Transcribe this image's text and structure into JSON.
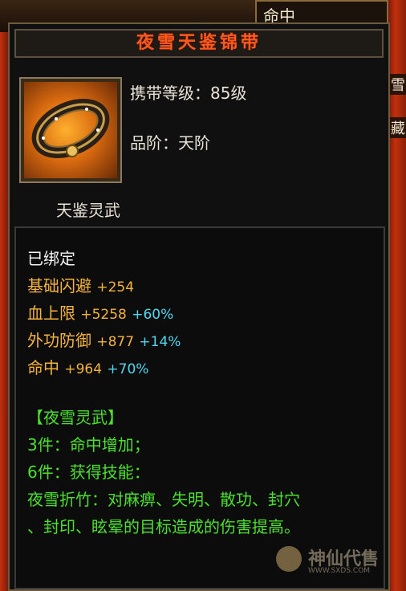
{
  "background": {
    "top_tab_label": "命中",
    "side_chars": [
      "雪",
      "藏"
    ]
  },
  "tooltip": {
    "title": "夜雪天鉴锦带",
    "icon": "belt-icon",
    "level_line": "携带等级：85级",
    "grade_line": "品阶：天阶",
    "subtitle": "天鉴灵武",
    "bound": "已绑定",
    "stats": [
      {
        "name": "基础闪避",
        "value": "+254",
        "percent": ""
      },
      {
        "name": "血上限",
        "value": "+5258",
        "percent": "+60%"
      },
      {
        "name": "外功防御",
        "value": "+877",
        "percent": "+14%"
      },
      {
        "name": "命中",
        "value": "+964",
        "percent": "+70%"
      }
    ],
    "set_name": "【夜雪灵武】",
    "set_lines": [
      "3件：命中增加；",
      "6件：获得技能：",
      "夜雪折竹：对麻痹、失明、散功、封穴",
      "、封印、眩晕的目标造成的伤害提高。"
    ]
  },
  "watermark": {
    "text": "神仙代售",
    "url": "WWW.SXDS.COM"
  },
  "colors": {
    "title": "#ff5a1e",
    "stat": "#f6b43a",
    "percent": "#4fd8f0",
    "set": "#4ae02c"
  }
}
